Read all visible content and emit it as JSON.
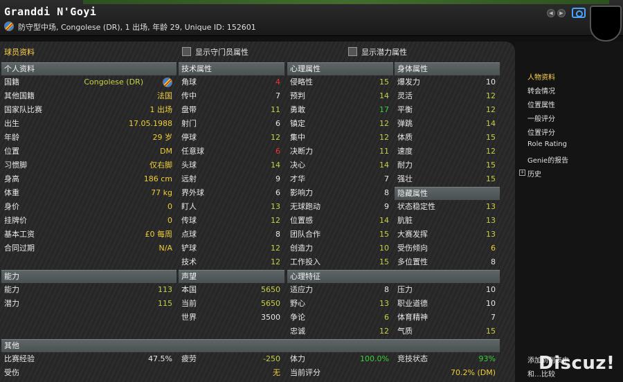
{
  "header": {
    "name": "Granddi N'Goyi",
    "subtitle": "防守型中场, Congolese (DR), 1 出场, 年龄 29, Unique ID: 152601"
  },
  "panel": {
    "title": "球员资料",
    "show_gk_attrs": "显示守门员属性",
    "show_potential_attrs": "显示潜力属性"
  },
  "personal": {
    "heading": "个人资料",
    "rows": [
      {
        "label": "国籍",
        "value": "Congolese (DR)"
      },
      {
        "label": "其他国籍",
        "value": "法国"
      },
      {
        "label": "国家队比赛",
        "value": "1 出场"
      },
      {
        "label": "出生",
        "value": "17.05.1988"
      },
      {
        "label": "年龄",
        "value": "29 岁"
      },
      {
        "label": "位置",
        "value": "DM"
      },
      {
        "label": "习惯脚",
        "value": "仅右脚"
      },
      {
        "label": "身高",
        "value": "186 cm"
      },
      {
        "label": "体重",
        "value": "77 kg"
      },
      {
        "label": "身价",
        "value": "0"
      },
      {
        "label": "挂牌价",
        "value": "0"
      },
      {
        "label": "基本工资",
        "value": "£0 每周"
      },
      {
        "label": "合同过期",
        "value": "N/A"
      }
    ]
  },
  "technical": {
    "heading": "技术属性",
    "rows": [
      {
        "label": "角球",
        "value": "4"
      },
      {
        "label": "传中",
        "value": "7"
      },
      {
        "label": "盘带",
        "value": "11"
      },
      {
        "label": "射门",
        "value": "6"
      },
      {
        "label": "停球",
        "value": "12"
      },
      {
        "label": "任意球",
        "value": "6"
      },
      {
        "label": "头球",
        "value": "14"
      },
      {
        "label": "远射",
        "value": "9"
      },
      {
        "label": "界外球",
        "value": "6"
      },
      {
        "label": "盯人",
        "value": "13"
      },
      {
        "label": "传球",
        "value": "12"
      },
      {
        "label": "点球",
        "value": "8"
      },
      {
        "label": "铲球",
        "value": "12"
      },
      {
        "label": "技术",
        "value": "12"
      }
    ]
  },
  "mental": {
    "heading": "心理属性",
    "rows": [
      {
        "label": "侵略性",
        "value": "15"
      },
      {
        "label": "预判",
        "value": "14"
      },
      {
        "label": "勇敢",
        "value": "17"
      },
      {
        "label": "镇定",
        "value": "12"
      },
      {
        "label": "集中",
        "value": "12"
      },
      {
        "label": "决断力",
        "value": "11"
      },
      {
        "label": "决心",
        "value": "14"
      },
      {
        "label": "才华",
        "value": "7"
      },
      {
        "label": "影响力",
        "value": "8"
      },
      {
        "label": "无球跑动",
        "value": "9"
      },
      {
        "label": "位置感",
        "value": "14"
      },
      {
        "label": "团队合作",
        "value": "15"
      },
      {
        "label": "创造力",
        "value": "10"
      },
      {
        "label": "工作投入",
        "value": "15"
      }
    ]
  },
  "physical": {
    "heading": "身体属性",
    "rows": [
      {
        "label": "爆发力",
        "value": "10"
      },
      {
        "label": "灵活",
        "value": "12"
      },
      {
        "label": "平衡",
        "value": "12"
      },
      {
        "label": "弹跳",
        "value": "14"
      },
      {
        "label": "体质",
        "value": "15"
      },
      {
        "label": "速度",
        "value": "12"
      },
      {
        "label": "耐力",
        "value": "15"
      },
      {
        "label": "强壮",
        "value": "15"
      }
    ]
  },
  "hidden": {
    "heading": "隐藏属性",
    "rows": [
      {
        "label": "状态稳定性",
        "value": "13"
      },
      {
        "label": "肮脏",
        "value": "13"
      },
      {
        "label": "大赛发挥",
        "value": "13"
      },
      {
        "label": "受伤倾向",
        "value": "6"
      },
      {
        "label": "多位置性",
        "value": "8"
      }
    ]
  },
  "ability": {
    "heading": "能力",
    "rows": [
      {
        "label": "能力",
        "value": "113"
      },
      {
        "label": "潜力",
        "value": "115"
      }
    ]
  },
  "reputation": {
    "heading": "声望",
    "rows": [
      {
        "label": "本国",
        "value": "5650"
      },
      {
        "label": "当前",
        "value": "5650"
      },
      {
        "label": "世界",
        "value": "3500"
      }
    ]
  },
  "traits": {
    "heading": "心理特征",
    "rows": [
      {
        "label": "适应力",
        "value": "8"
      },
      {
        "label": "野心",
        "value": "13"
      },
      {
        "label": "争论",
        "value": "6"
      },
      {
        "label": "忠诚",
        "value": "12"
      },
      {
        "label": "压力",
        "value": "10"
      },
      {
        "label": "职业道德",
        "value": "10"
      },
      {
        "label": "体育精神",
        "value": "7"
      },
      {
        "label": "气质",
        "value": "15"
      }
    ]
  },
  "other": {
    "heading": "其他",
    "rows": [
      {
        "label": "比赛经验",
        "value": "47.5%"
      },
      {
        "label": "受伤",
        "value": ""
      },
      {
        "label": "疲劳",
        "value": "-250"
      },
      {
        "label": "",
        "value": "无"
      },
      {
        "label": "体力",
        "value": "100.0%"
      },
      {
        "label": "当前评分",
        "value": "70.2% (DM)"
      },
      {
        "label": "竞技状态",
        "value": "93%"
      }
    ]
  },
  "sidebar": {
    "items": [
      "人物资料",
      "转会情况",
      "位置属性",
      "一般评分",
      "位置评分",
      "Role Rating",
      "Genie的报告",
      "历史"
    ],
    "footer_1": "添加到列表中",
    "footer_2": "和…比较"
  },
  "watermark": "Discuz!"
}
